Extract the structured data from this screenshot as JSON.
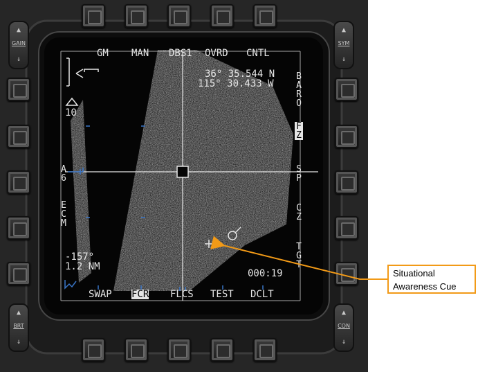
{
  "top_menu": [
    "GM",
    "MAN",
    "DBS1",
    "OVRD",
    "CNTL"
  ],
  "bottom_menu": [
    "SWAP",
    "FCR",
    "FLCS",
    "TEST",
    "DCLT"
  ],
  "bottom_selected": "FCR",
  "coords": {
    "lat": "36° 35.544 N",
    "lon": "115° 30.433 W"
  },
  "range": "10",
  "left_labels": {
    "az": "A6",
    "mode": "ECM"
  },
  "right_labels": {
    "baro": "BARO",
    "fz": "FZ",
    "sp": "SP",
    "cz": "CZ",
    "tgt": "TGT"
  },
  "cursor_readout": {
    "bearing": "-157°",
    "distance": "1.2 NM"
  },
  "timer": "000:19",
  "rockers": {
    "left_top": "GAIN",
    "right_top": "SYM",
    "left_bottom": "BRT",
    "right_bottom": "CON"
  },
  "callout": {
    "line1": "Situational",
    "line2": "Awareness Cue",
    "border_color": "#f29a17"
  },
  "colors": {
    "display_text": "#e6e6e6",
    "cursor_blue": "#3a76c9"
  }
}
